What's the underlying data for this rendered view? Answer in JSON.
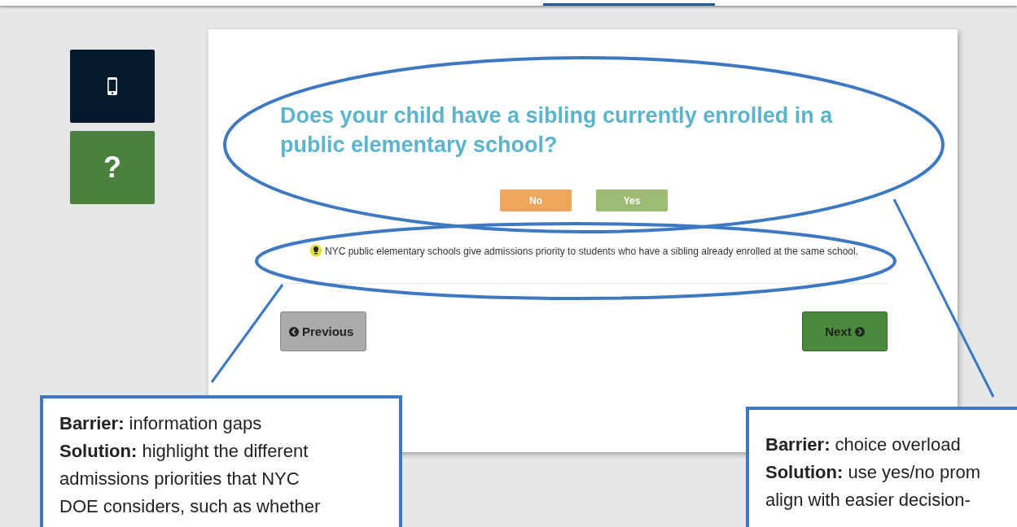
{
  "sidebar": {
    "items": [
      {
        "kind": "phone"
      },
      {
        "kind": "help",
        "label": "?"
      }
    ]
  },
  "question": {
    "title": "Does your child have a sibling currently enrolled in a public elementary school?",
    "answers": [
      {
        "label": "No",
        "kind": "no"
      },
      {
        "label": "Yes",
        "kind": "yes"
      }
    ],
    "tip": "NYC public elementary schools give admissions priority to students who have a sibling already enrolled at the same school."
  },
  "navigation": {
    "previous": "Previous",
    "next": "Next"
  },
  "callouts": [
    {
      "lines": [
        "**Barrier:** information gaps",
        "**Solution:** highlight the different",
        "admissions priorities that NYC",
        "DOE considers, such as whether"
      ]
    },
    {
      "lines": [
        "**Barrier:** choice overload",
        "**Solution:** use yes/no prom",
        "align with easier decision-"
      ]
    }
  ]
}
